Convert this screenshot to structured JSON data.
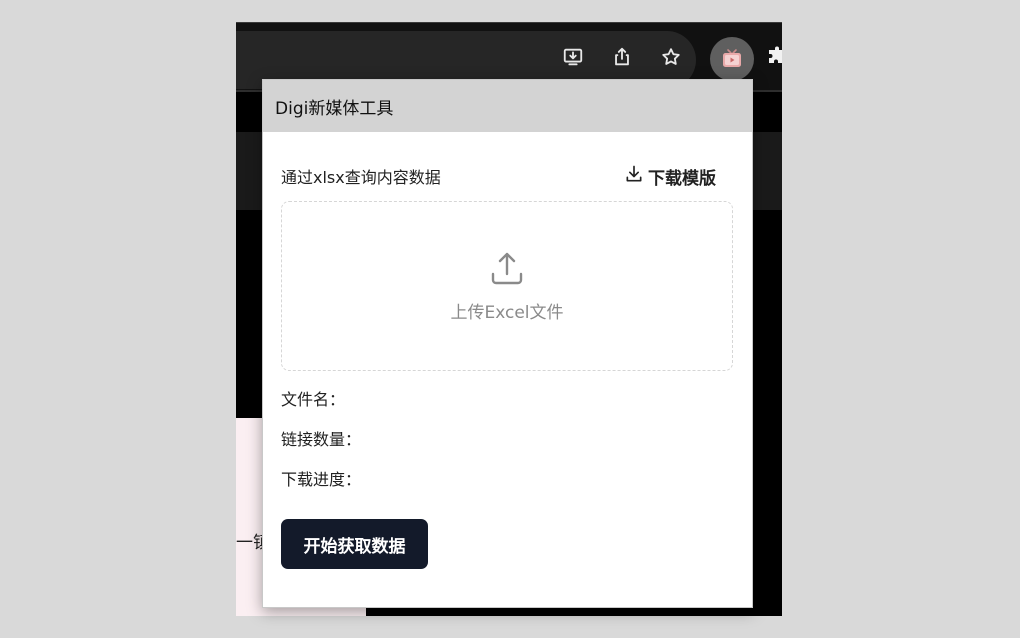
{
  "browser": {
    "side_text": "一镇"
  },
  "icons": {
    "install": "install-app-icon",
    "share": "share-icon",
    "bookmark": "star-icon",
    "extension": "tv-extension-icon",
    "extensions_menu": "puzzle-icon",
    "download": "download-icon",
    "upload": "upload-icon"
  },
  "popup": {
    "title": "Digi新媒体工具",
    "query_label": "通过xlsx查询内容数据",
    "download_template_label": "下载模版",
    "upload_label": "上传Excel文件",
    "file_name_label": "文件名：",
    "link_count_label": "链接数量：",
    "download_progress_label": "下载进度：",
    "start_button_label": "开始获取数据"
  },
  "colors": {
    "header_bg": "#d3d3d3",
    "button_bg": "#131a2a",
    "upload_text": "#8a8a8a"
  }
}
